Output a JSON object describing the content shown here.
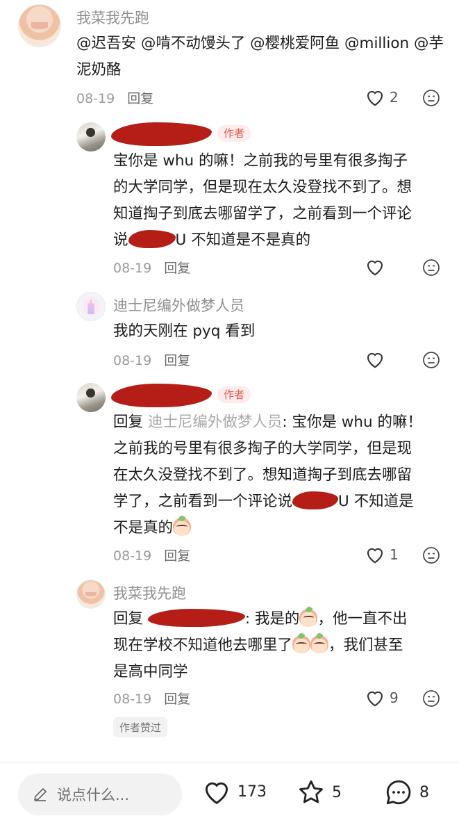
{
  "comments": [
    {
      "user": "我菜我先跑",
      "mentions": "@迟吾安 @啃不动馒头了 @樱桃爱阿鱼 @million @芋泥奶酪",
      "date": "08-19",
      "reply_label": "回复",
      "likes": "2"
    },
    {
      "author_badge": "作者",
      "text": [
        "宝你是 whu 的嘛！之前我的号里有很多掏子",
        "的大学同学，但是现在太久没登找不到了。想",
        "知道掏子到底去哪留学了，之前看到一个评论",
        "说",
        "U 不知道是不是真的"
      ],
      "date": "08-19",
      "reply_label": "回复"
    },
    {
      "user": "迪士尼编外做梦人员",
      "text": "我的天刚在 pyq 看到",
      "date": "08-19",
      "reply_label": "回复"
    },
    {
      "author_badge": "作者",
      "reply_prefix": "回复",
      "reply_target": "迪士尼编外做梦人员",
      "text": [
        ": 宝你是 whu 的嘛！",
        "之前我的号里有很多掏子的大学同学，但是现",
        "在太久没登找不到了。想知道掏子到底去哪留",
        "学了，之前看到一个评论说",
        "U 不知道是",
        "不是真的"
      ],
      "date": "08-19",
      "reply_label": "回复",
      "likes": "1"
    },
    {
      "user": "我菜我先跑",
      "reply_prefix": "回复",
      "text": [
        ": 我是的",
        "，他一直不出",
        "现在学校不知道他去哪里了",
        "，我们甚至",
        "是高中同学"
      ],
      "date": "08-19",
      "reply_label": "回复",
      "likes": "9",
      "liked_by_author": "作者赞过"
    }
  ],
  "bottom_bar": {
    "input_placeholder": "说点什么...",
    "like_count": "173",
    "collect_count": "5",
    "comment_count": "8"
  },
  "colors": {
    "redaction": "#b51e16",
    "author_badge_text": "#e05a4f",
    "author_badge_bg": "#fdeceb"
  },
  "icons": [
    "heart-icon",
    "dislike-face-icon",
    "pencil-icon",
    "star-icon",
    "comment-bubble-icon"
  ]
}
